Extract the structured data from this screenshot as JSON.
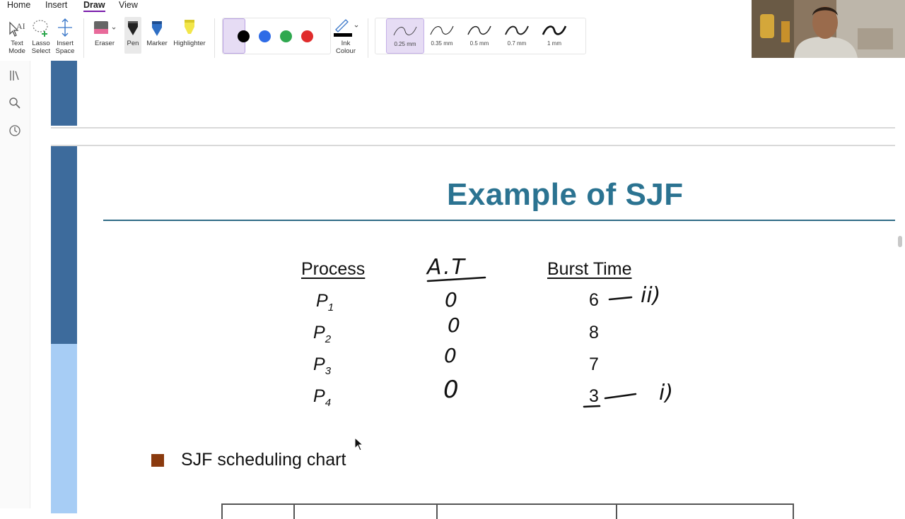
{
  "menu": {
    "home": "Home",
    "insert": "Insert",
    "draw": "Draw",
    "view": "View"
  },
  "ribbon": {
    "text_mode": "Text Mode",
    "lasso_select": "Lasso Select",
    "insert_space": "Insert Space",
    "eraser": "Eraser",
    "pen": "Pen",
    "marker": "Marker",
    "highlighter": "Highlighter",
    "ink_colour": "Ink Colour",
    "ink_colors": [
      "#000000",
      "#2e6be6",
      "#2fa84f",
      "#e02c2c"
    ],
    "selected_color": "#000000",
    "thickness": [
      "0.25 mm",
      "0.35 mm",
      "0.5 mm",
      "0.7 mm",
      "1 mm"
    ],
    "selected_thickness": "0.25 mm"
  },
  "slide": {
    "title": "Example of SJF",
    "headers": {
      "process": "Process",
      "burst": "Burst Time"
    },
    "rows": [
      {
        "p": "P",
        "sub": "1",
        "burst": "6"
      },
      {
        "p": "P",
        "sub": "2",
        "burst": "8"
      },
      {
        "p": "P",
        "sub": "3",
        "burst": "7"
      },
      {
        "p": "P",
        "sub": "4",
        "burst": "3"
      }
    ],
    "bullet": "SJF scheduling chart"
  },
  "handwriting": {
    "header": "A.T",
    "arrival": [
      "0",
      "0",
      "0",
      "0"
    ],
    "order": [
      "ii)",
      "i)"
    ]
  },
  "colors": {
    "accent": "#7719aa",
    "title": "#2b7391",
    "bar_dark": "#3d6b9c",
    "bar_light": "#a7cdf5",
    "bullet": "#8a3a0e"
  }
}
